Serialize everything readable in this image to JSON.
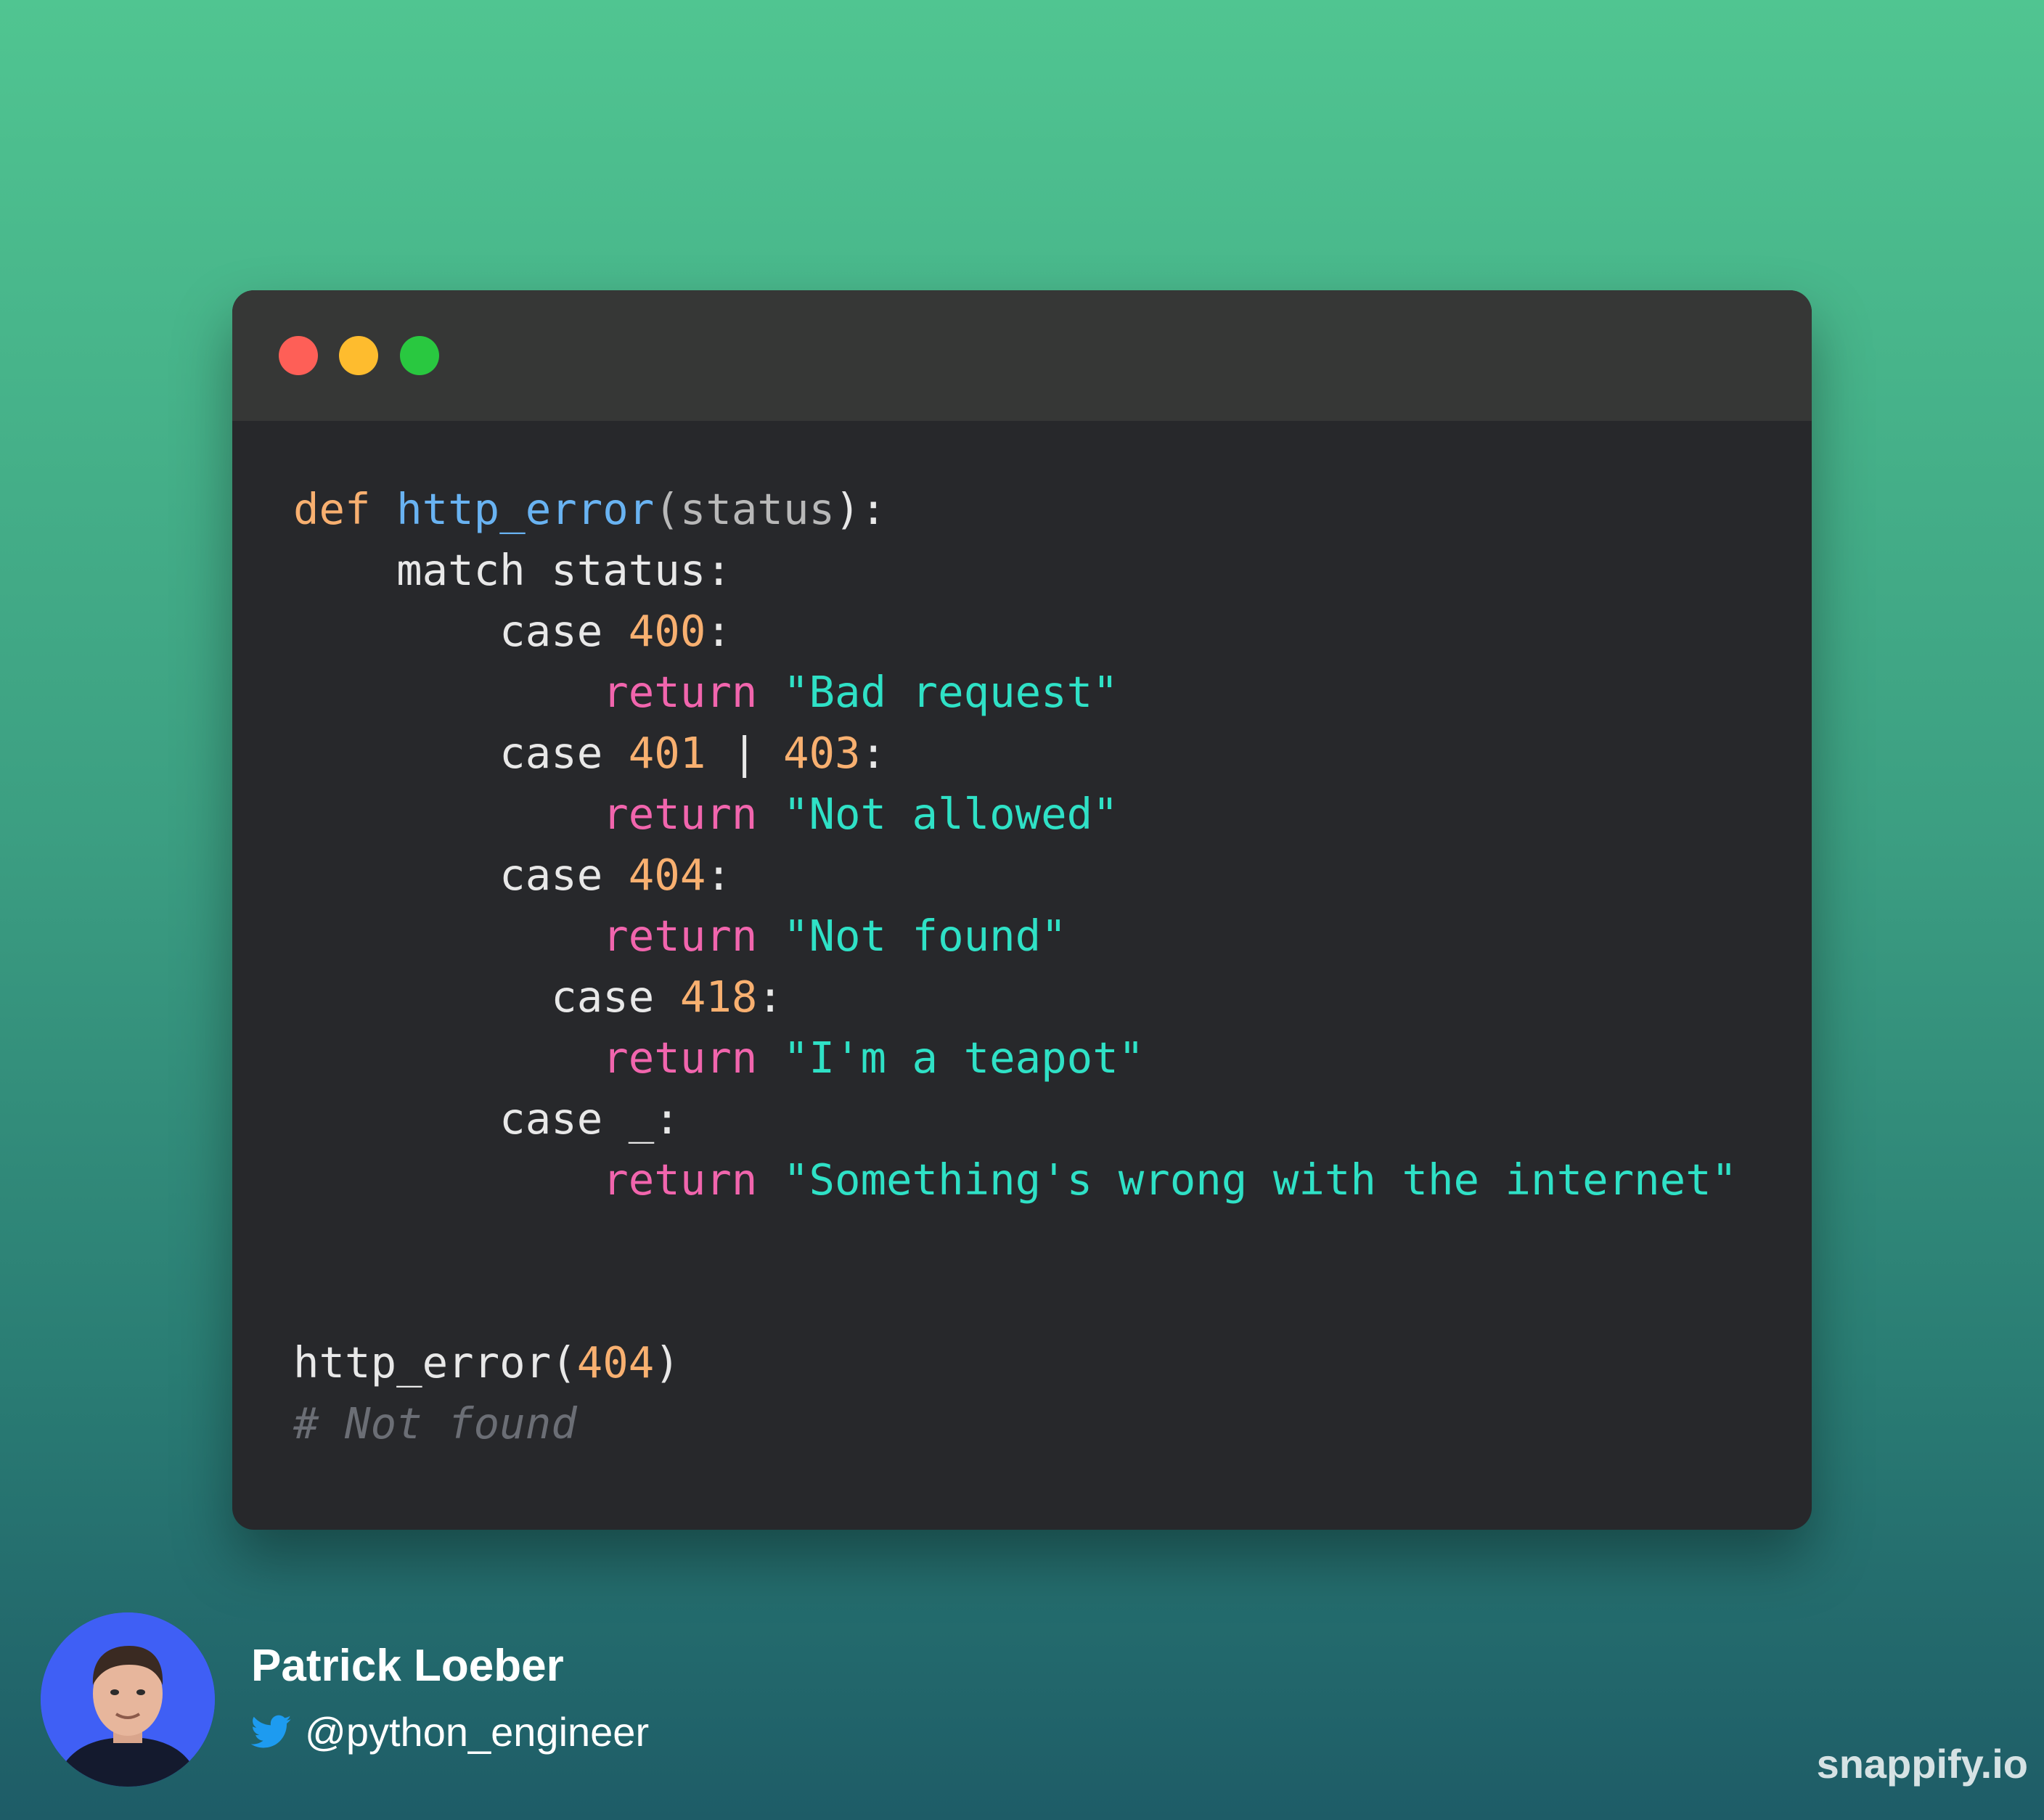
{
  "window": {
    "buttons": {
      "close_color": "#fe5f57",
      "minimize_color": "#febc2e",
      "maximize_color": "#29c840"
    }
  },
  "code": {
    "language": "python",
    "lines": [
      [
        {
          "t": "def",
          "k": "kw-def"
        },
        {
          "t": " ",
          "k": ""
        },
        {
          "t": "http_error",
          "k": "fn"
        },
        {
          "t": "(",
          "k": "param"
        },
        {
          "t": "status",
          "k": "param"
        },
        {
          "t": "):",
          "k": ""
        }
      ],
      [
        {
          "t": "    match status:",
          "k": ""
        }
      ],
      [
        {
          "t": "        case ",
          "k": ""
        },
        {
          "t": "400",
          "k": "num"
        },
        {
          "t": ":",
          "k": ""
        }
      ],
      [
        {
          "t": "            ",
          "k": ""
        },
        {
          "t": "return",
          "k": "ret"
        },
        {
          "t": " ",
          "k": ""
        },
        {
          "t": "\"Bad request\"",
          "k": "str"
        }
      ],
      [
        {
          "t": "        case ",
          "k": ""
        },
        {
          "t": "401",
          "k": "num"
        },
        {
          "t": " | ",
          "k": ""
        },
        {
          "t": "403",
          "k": "num"
        },
        {
          "t": ":",
          "k": ""
        }
      ],
      [
        {
          "t": "            ",
          "k": ""
        },
        {
          "t": "return",
          "k": "ret"
        },
        {
          "t": " ",
          "k": ""
        },
        {
          "t": "\"Not allowed\"",
          "k": "str"
        }
      ],
      [
        {
          "t": "        case ",
          "k": ""
        },
        {
          "t": "404",
          "k": "num"
        },
        {
          "t": ":",
          "k": ""
        }
      ],
      [
        {
          "t": "            ",
          "k": ""
        },
        {
          "t": "return",
          "k": "ret"
        },
        {
          "t": " ",
          "k": ""
        },
        {
          "t": "\"Not found\"",
          "k": "str"
        }
      ],
      [
        {
          "t": "          case ",
          "k": ""
        },
        {
          "t": "418",
          "k": "num"
        },
        {
          "t": ":",
          "k": ""
        }
      ],
      [
        {
          "t": "            ",
          "k": ""
        },
        {
          "t": "return",
          "k": "ret"
        },
        {
          "t": " ",
          "k": ""
        },
        {
          "t": "\"I'm a teapot\"",
          "k": "str"
        }
      ],
      [
        {
          "t": "        case _:",
          "k": ""
        }
      ],
      [
        {
          "t": "            ",
          "k": ""
        },
        {
          "t": "return",
          "k": "ret"
        },
        {
          "t": " ",
          "k": ""
        },
        {
          "t": "\"Something's wrong with the internet\"",
          "k": "str"
        }
      ],
      [],
      [],
      [
        {
          "t": "http_error(",
          "k": ""
        },
        {
          "t": "404",
          "k": "num"
        },
        {
          "t": ")",
          "k": ""
        }
      ],
      [
        {
          "t": "# Not found",
          "k": "comment"
        }
      ]
    ]
  },
  "author": {
    "name": "Patrick Loeber",
    "handle": "@python_engineer",
    "twitter_icon": "twitter-bird-icon",
    "avatar_bg": "#3f5ff5"
  },
  "watermark": "snappify.io"
}
